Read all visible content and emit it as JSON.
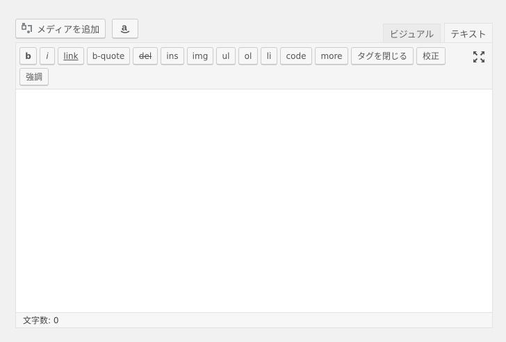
{
  "media_buttons": {
    "add_media_label": "メディアを追加",
    "amazon_label": "a"
  },
  "tabs": {
    "visual": "ビジュアル",
    "text": "テキスト",
    "active": "text"
  },
  "toolbar": {
    "buttons": [
      {
        "label": "b"
      },
      {
        "label": "i"
      },
      {
        "label": "link"
      },
      {
        "label": "b-quote"
      },
      {
        "label": "del"
      },
      {
        "label": "ins"
      },
      {
        "label": "img"
      },
      {
        "label": "ul"
      },
      {
        "label": "ol"
      },
      {
        "label": "li"
      },
      {
        "label": "code"
      },
      {
        "label": "more"
      },
      {
        "label": "タグを閉じる"
      },
      {
        "label": "校正"
      },
      {
        "label": "強調"
      }
    ]
  },
  "editor": {
    "content": ""
  },
  "status": {
    "word_count": "文字数: 0"
  }
}
